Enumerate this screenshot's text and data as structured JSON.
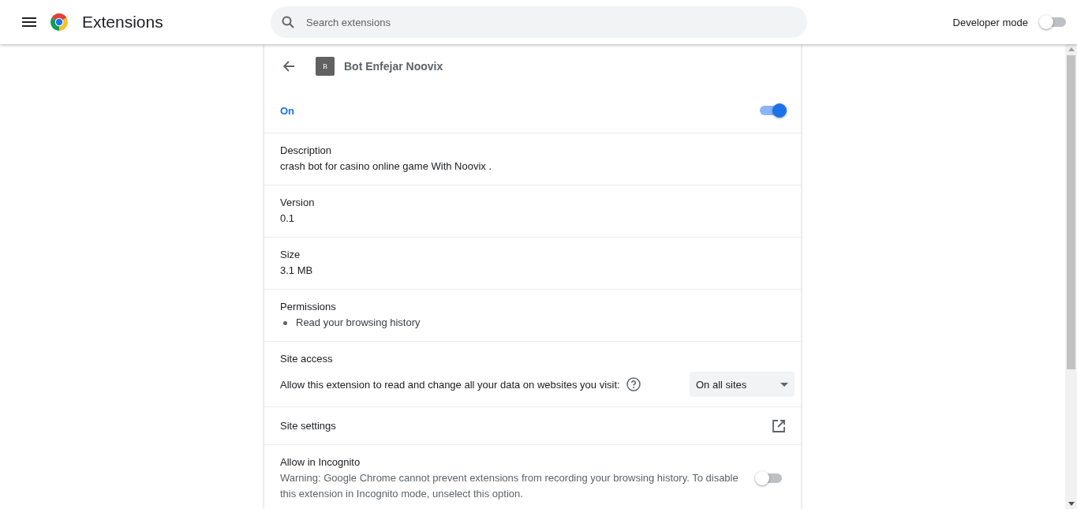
{
  "toolbar": {
    "title": "Extensions",
    "search": {
      "placeholder": "Search extensions"
    },
    "developer_mode": {
      "label": "Developer mode",
      "on": false
    }
  },
  "detail": {
    "icon_letter": "B",
    "name": "Bot Enfejar Noovix",
    "enabled": {
      "label": "On",
      "on": true
    },
    "sections": [
      {
        "kind": "text",
        "label": "Description",
        "value": "crash bot for casino online game With Noovix ."
      },
      {
        "kind": "text",
        "label": "Version",
        "value": "0.1"
      },
      {
        "kind": "text",
        "label": "Size",
        "value": "3.1 MB"
      },
      {
        "kind": "list",
        "label": "Permissions",
        "items": [
          "Read your browsing history"
        ]
      }
    ],
    "site_access": {
      "label": "Site access",
      "text": "Allow this extension to read and change all your data on websites you visit:",
      "value": "On all sites"
    },
    "site_settings": {
      "label": "Site settings"
    },
    "incognito": {
      "label": "Allow in Incognito",
      "warning": "Warning: Google Chrome cannot prevent extensions from recording your browsing history. To disable this extension in Incognito mode, unselect this option.",
      "on": false
    }
  }
}
